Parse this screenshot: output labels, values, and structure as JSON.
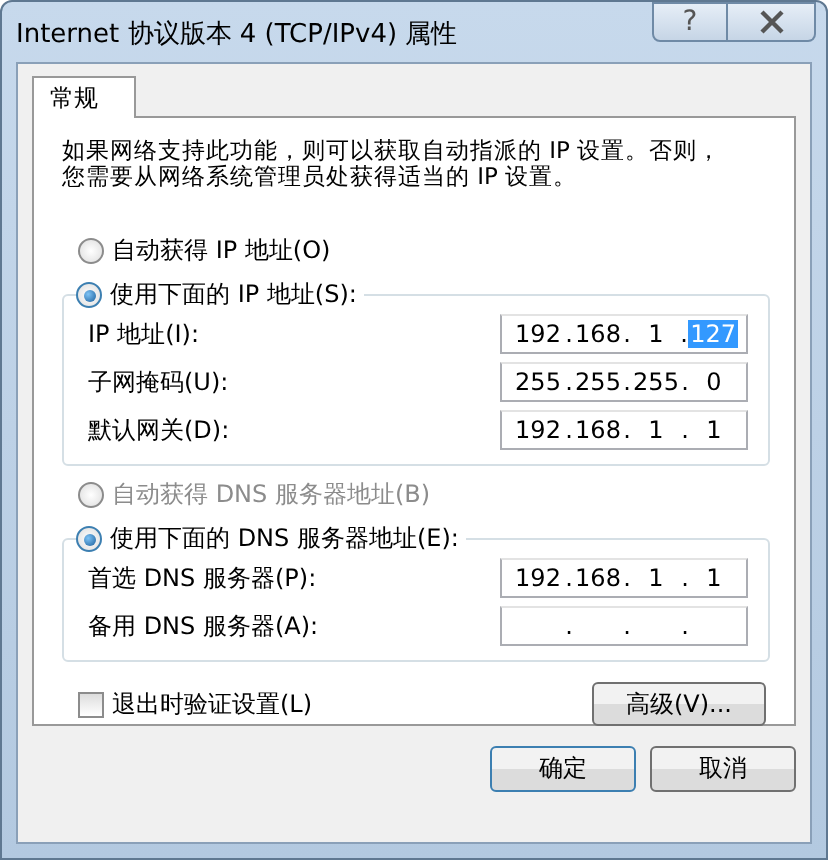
{
  "window": {
    "title": "Internet 协议版本 4 (TCP/IPv4) 属性",
    "help_button": "?"
  },
  "tabs": [
    {
      "label": "常规",
      "selected": true
    }
  ],
  "intro": [
    "如果网络支持此功能，则可以获取自动指派的 IP 设置。否则，",
    "您需要从网络系统管理员处获得适当的 IP 设置。"
  ],
  "ip_auto": {
    "label": "自动获得 IP 地址(O)",
    "selected": false,
    "disabled": false
  },
  "ip_manual": {
    "label": "使用下面的 IP 地址(S):",
    "selected": true,
    "disabled": false,
    "fields": [
      {
        "label": "IP 地址(I):",
        "octets": [
          {
            "text": "192",
            "selected": false
          },
          {
            "dot": ".",
            "text": "168",
            "selected": false
          },
          {
            "dot": ".",
            "text": "1",
            "selected": false
          },
          {
            "dot": ".",
            "text": "127",
            "selected": true
          }
        ]
      },
      {
        "label": "子网掩码(U):",
        "octets": [
          {
            "text": "255",
            "selected": false
          },
          {
            "dot": ".",
            "text": "255",
            "selected": false
          },
          {
            "dot": ".",
            "text": "255",
            "selected": false
          },
          {
            "dot": ".",
            "text": "0",
            "selected": false
          }
        ]
      },
      {
        "label": "默认网关(D):",
        "octets": [
          {
            "text": "192",
            "selected": false
          },
          {
            "dot": ".",
            "text": "168",
            "selected": false
          },
          {
            "dot": ".",
            "text": "1",
            "selected": false
          },
          {
            "dot": ".",
            "text": "1",
            "selected": false
          }
        ]
      }
    ]
  },
  "dns_auto": {
    "label": "自动获得 DNS 服务器地址(B)",
    "selected": false,
    "disabled": true
  },
  "dns_manual": {
    "label": "使用下面的 DNS 服务器地址(E):",
    "selected": true,
    "disabled": false,
    "fields": [
      {
        "label": "首选 DNS 服务器(P):",
        "octets": [
          {
            "text": "192",
            "selected": false
          },
          {
            "dot": ".",
            "text": "168",
            "selected": false
          },
          {
            "dot": ".",
            "text": "1",
            "selected": false
          },
          {
            "dot": ".",
            "text": "1",
            "selected": false
          }
        ]
      },
      {
        "label": "备用 DNS 服务器(A):",
        "octets": [
          {
            "dot": "."
          },
          {
            "dot": "."
          },
          {
            "dot": "."
          }
        ]
      }
    ]
  },
  "validate": {
    "label": "退出时验证设置(L)",
    "checked": false
  },
  "advanced_button": "高级(V)...",
  "buttons": [
    "确定",
    "取消"
  ]
}
